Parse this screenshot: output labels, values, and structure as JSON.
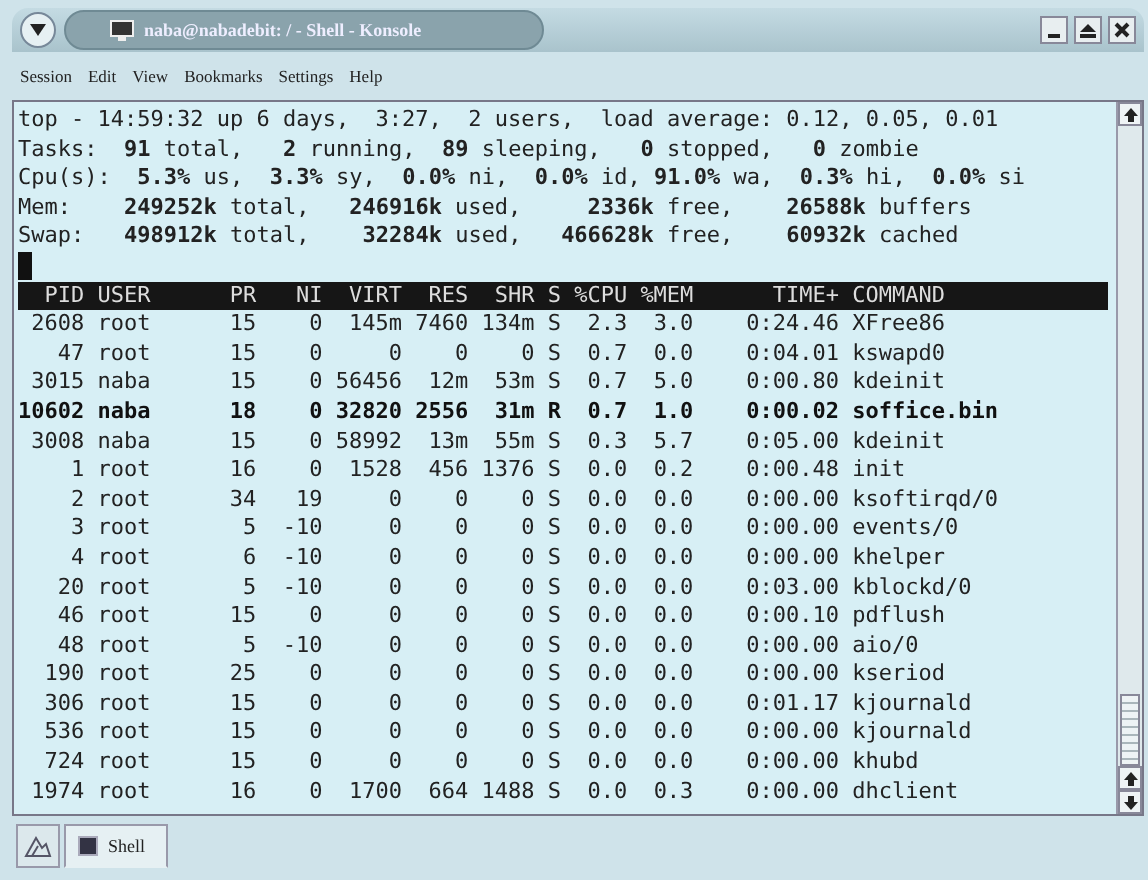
{
  "window": {
    "title": "naba@nabadebit: / - Shell - Konsole"
  },
  "menu": [
    "Session",
    "Edit",
    "View",
    "Bookmarks",
    "Settings",
    "Help"
  ],
  "terminal": {
    "summary": [
      "top - 14:59:32 up 6 days,  3:27,  2 users,  load average: 0.12, 0.05, 0.01",
      "Tasks:  **91** total,   **2** running,  **89** sleeping,   **0** stopped,   **0** zombie",
      "Cpu(s):  **5.3%** us,  **3.3%** sy,  **0.0%** ni,  **0.0%** id, **91.0%** wa,  **0.3%** hi,  **0.0%** si",
      "Mem:    **249252k** total,   **246916k** used,     **2336k** free,    **26588k** buffers",
      "Swap:   **498912k** total,    **32284k** used,   **466628k** free,    **60932k** cached"
    ],
    "columns": [
      "PID",
      "USER",
      "PR",
      "NI",
      "VIRT",
      "RES",
      "SHR",
      "S",
      "%CPU",
      "%MEM",
      "TIME+",
      "COMMAND"
    ],
    "processes": [
      {
        "cells": [
          "2608",
          "root",
          "15",
          "0",
          "145m",
          "7460",
          "134m",
          "S",
          "2.3",
          "3.0",
          "0:24.46",
          "XFree86"
        ],
        "highlighted": false
      },
      {
        "cells": [
          "47",
          "root",
          "15",
          "0",
          "0",
          "0",
          "0",
          "S",
          "0.7",
          "0.0",
          "0:04.01",
          "kswapd0"
        ],
        "highlighted": false
      },
      {
        "cells": [
          "3015",
          "naba",
          "15",
          "0",
          "56456",
          "12m",
          "53m",
          "S",
          "0.7",
          "5.0",
          "0:00.80",
          "kdeinit"
        ],
        "highlighted": false
      },
      {
        "cells": [
          "10602",
          "naba",
          "18",
          "0",
          "32820",
          "2556",
          "31m",
          "R",
          "0.7",
          "1.0",
          "0:00.02",
          "soffice.bin"
        ],
        "highlighted": true
      },
      {
        "cells": [
          "3008",
          "naba",
          "15",
          "0",
          "58992",
          "13m",
          "55m",
          "S",
          "0.3",
          "5.7",
          "0:05.00",
          "kdeinit"
        ],
        "highlighted": false
      },
      {
        "cells": [
          "1",
          "root",
          "16",
          "0",
          "1528",
          "456",
          "1376",
          "S",
          "0.0",
          "0.2",
          "0:00.48",
          "init"
        ],
        "highlighted": false
      },
      {
        "cells": [
          "2",
          "root",
          "34",
          "19",
          "0",
          "0",
          "0",
          "S",
          "0.0",
          "0.0",
          "0:00.00",
          "ksoftirqd/0"
        ],
        "highlighted": false
      },
      {
        "cells": [
          "3",
          "root",
          "5",
          "-10",
          "0",
          "0",
          "0",
          "S",
          "0.0",
          "0.0",
          "0:00.00",
          "events/0"
        ],
        "highlighted": false
      },
      {
        "cells": [
          "4",
          "root",
          "6",
          "-10",
          "0",
          "0",
          "0",
          "S",
          "0.0",
          "0.0",
          "0:00.00",
          "khelper"
        ],
        "highlighted": false
      },
      {
        "cells": [
          "20",
          "root",
          "5",
          "-10",
          "0",
          "0",
          "0",
          "S",
          "0.0",
          "0.0",
          "0:03.00",
          "kblockd/0"
        ],
        "highlighted": false
      },
      {
        "cells": [
          "46",
          "root",
          "15",
          "0",
          "0",
          "0",
          "0",
          "S",
          "0.0",
          "0.0",
          "0:00.10",
          "pdflush"
        ],
        "highlighted": false
      },
      {
        "cells": [
          "48",
          "root",
          "5",
          "-10",
          "0",
          "0",
          "0",
          "S",
          "0.0",
          "0.0",
          "0:00.00",
          "aio/0"
        ],
        "highlighted": false
      },
      {
        "cells": [
          "190",
          "root",
          "25",
          "0",
          "0",
          "0",
          "0",
          "S",
          "0.0",
          "0.0",
          "0:00.00",
          "kseriod"
        ],
        "highlighted": false
      },
      {
        "cells": [
          "306",
          "root",
          "15",
          "0",
          "0",
          "0",
          "0",
          "S",
          "0.0",
          "0.0",
          "0:01.17",
          "kjournald"
        ],
        "highlighted": false
      },
      {
        "cells": [
          "536",
          "root",
          "15",
          "0",
          "0",
          "0",
          "0",
          "S",
          "0.0",
          "0.0",
          "0:00.00",
          "kjournald"
        ],
        "highlighted": false
      },
      {
        "cells": [
          "724",
          "root",
          "15",
          "0",
          "0",
          "0",
          "0",
          "S",
          "0.0",
          "0.0",
          "0:00.00",
          "khubd"
        ],
        "highlighted": false
      },
      {
        "cells": [
          "1974",
          "root",
          "16",
          "0",
          "1700",
          "664",
          "1488",
          "S",
          "0.0",
          "0.3",
          "0:00.00",
          "dhclient"
        ],
        "highlighted": false
      }
    ]
  },
  "tabs": [
    {
      "label": "Shell",
      "selected": true
    }
  ]
}
